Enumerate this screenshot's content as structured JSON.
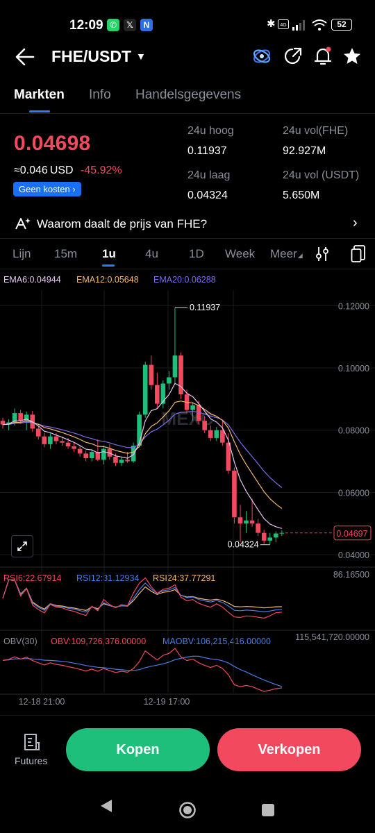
{
  "status_bar": {
    "time": "12:09",
    "apps": [
      "whatsapp-icon",
      "x-icon",
      "n-icon"
    ],
    "battery": "52"
  },
  "header": {
    "pair": "FHE/USDT",
    "icons": [
      "back-arrow-icon",
      "eye-icon",
      "share-icon",
      "bell-icon",
      "star-icon"
    ]
  },
  "tabs": [
    {
      "label": "Markten",
      "active": true
    },
    {
      "label": "Info",
      "active": false
    },
    {
      "label": "Handelsgegevens",
      "active": false
    }
  ],
  "price": {
    "last": "0.04698",
    "approx": "≈0.046",
    "approx_currency": "USD",
    "change": "-45.92%",
    "badge": "Geen kosten",
    "color_down": "#f2495e"
  },
  "stats": {
    "high_label": "24u hoog",
    "high": "0.11937",
    "vol_fhe_label": "24u vol(FHE)",
    "vol_fhe": "92.927M",
    "low_label": "24u laag",
    "low": "0.04324",
    "vol_usdt_label": "24u vol (USDT)",
    "vol_usdt": "5.650M"
  },
  "why_banner": {
    "text": "Waarom daalt de prijs van FHE?"
  },
  "intervals": [
    {
      "label": "Lijn"
    },
    {
      "label": "15m"
    },
    {
      "label": "1u",
      "active": true
    },
    {
      "label": "4u"
    },
    {
      "label": "1D"
    },
    {
      "label": "Week"
    },
    {
      "label": "Meer"
    }
  ],
  "indicators": {
    "ema6": "EMA6:0.04944",
    "ema12": "EMA12:0.05648",
    "ema20": "EMA20:0.06288",
    "rsi6": "RSI6:22.67914",
    "rsi12": "RSI12:31.12934",
    "rsi24": "RSI24:37.77291",
    "obv_title": "OBV(30)",
    "obv": "OBV:109,726,376.00000",
    "maobv": "MAOBV:106,215,416.00000"
  },
  "chart_data": {
    "type": "candlestick",
    "y_ticks": [
      "0.12000",
      "0.10000",
      "0.08000",
      "0.06000",
      "0.04000"
    ],
    "ylim": [
      0.038,
      0.125
    ],
    "x_ticks": [
      "12-18 21:00",
      "12-19 17:00"
    ],
    "high_marker": "0.11937",
    "low_marker": "0.04324",
    "last_price_tag": "0.04697",
    "rsi_max_label": "86.16500",
    "obv_max_label": "115,541,720.00000",
    "colors": {
      "up": "#1ebf7b",
      "down": "#f2495e",
      "ema6": "#e8c5f0",
      "ema12": "#f5b871",
      "ema20": "#7c6cf0",
      "rsi12": "#4a7de8"
    },
    "candles": [
      {
        "o": 0.083,
        "h": 0.084,
        "l": 0.0805,
        "c": 0.0818
      },
      {
        "o": 0.0818,
        "h": 0.0835,
        "l": 0.08,
        "c": 0.0825
      },
      {
        "o": 0.0825,
        "h": 0.087,
        "l": 0.0815,
        "c": 0.0855
      },
      {
        "o": 0.0855,
        "h": 0.0865,
        "l": 0.082,
        "c": 0.083
      },
      {
        "o": 0.083,
        "h": 0.086,
        "l": 0.08,
        "c": 0.085
      },
      {
        "o": 0.085,
        "h": 0.0862,
        "l": 0.0795,
        "c": 0.0805
      },
      {
        "o": 0.0805,
        "h": 0.0815,
        "l": 0.077,
        "c": 0.078
      },
      {
        "o": 0.078,
        "h": 0.0792,
        "l": 0.0745,
        "c": 0.0755
      },
      {
        "o": 0.0755,
        "h": 0.079,
        "l": 0.074,
        "c": 0.078
      },
      {
        "o": 0.078,
        "h": 0.079,
        "l": 0.0755,
        "c": 0.0765
      },
      {
        "o": 0.0765,
        "h": 0.078,
        "l": 0.075,
        "c": 0.076
      },
      {
        "o": 0.076,
        "h": 0.0775,
        "l": 0.074,
        "c": 0.0748
      },
      {
        "o": 0.0748,
        "h": 0.076,
        "l": 0.073,
        "c": 0.074
      },
      {
        "o": 0.074,
        "h": 0.075,
        "l": 0.0715,
        "c": 0.0725
      },
      {
        "o": 0.0725,
        "h": 0.0735,
        "l": 0.07,
        "c": 0.071
      },
      {
        "o": 0.071,
        "h": 0.074,
        "l": 0.07,
        "c": 0.073
      },
      {
        "o": 0.073,
        "h": 0.077,
        "l": 0.07,
        "c": 0.0705
      },
      {
        "o": 0.0705,
        "h": 0.075,
        "l": 0.069,
        "c": 0.074
      },
      {
        "o": 0.074,
        "h": 0.0755,
        "l": 0.0705,
        "c": 0.0715
      },
      {
        "o": 0.0715,
        "h": 0.0725,
        "l": 0.0685,
        "c": 0.0695
      },
      {
        "o": 0.0695,
        "h": 0.0715,
        "l": 0.0685,
        "c": 0.0705
      },
      {
        "o": 0.0705,
        "h": 0.073,
        "l": 0.0695,
        "c": 0.07
      },
      {
        "o": 0.07,
        "h": 0.076,
        "l": 0.0695,
        "c": 0.075
      },
      {
        "o": 0.075,
        "h": 0.086,
        "l": 0.0745,
        "c": 0.085
      },
      {
        "o": 0.085,
        "h": 0.102,
        "l": 0.084,
        "c": 0.101
      },
      {
        "o": 0.101,
        "h": 0.104,
        "l": 0.093,
        "c": 0.0945
      },
      {
        "o": 0.0945,
        "h": 0.0985,
        "l": 0.087,
        "c": 0.0885
      },
      {
        "o": 0.0885,
        "h": 0.096,
        "l": 0.087,
        "c": 0.095
      },
      {
        "o": 0.095,
        "h": 0.099,
        "l": 0.093,
        "c": 0.097
      },
      {
        "o": 0.097,
        "h": 0.1194,
        "l": 0.095,
        "c": 0.104
      },
      {
        "o": 0.104,
        "h": 0.105,
        "l": 0.09,
        "c": 0.0915
      },
      {
        "o": 0.0915,
        "h": 0.093,
        "l": 0.0855,
        "c": 0.0865
      },
      {
        "o": 0.0865,
        "h": 0.089,
        "l": 0.083,
        "c": 0.088
      },
      {
        "o": 0.088,
        "h": 0.0895,
        "l": 0.082,
        "c": 0.083
      },
      {
        "o": 0.083,
        "h": 0.0845,
        "l": 0.079,
        "c": 0.08
      },
      {
        "o": 0.08,
        "h": 0.0815,
        "l": 0.0765,
        "c": 0.0775
      },
      {
        "o": 0.0775,
        "h": 0.081,
        "l": 0.0765,
        "c": 0.08
      },
      {
        "o": 0.08,
        "h": 0.083,
        "l": 0.075,
        "c": 0.076
      },
      {
        "o": 0.076,
        "h": 0.079,
        "l": 0.066,
        "c": 0.067
      },
      {
        "o": 0.067,
        "h": 0.068,
        "l": 0.05,
        "c": 0.052
      },
      {
        "o": 0.052,
        "h": 0.056,
        "l": 0.044,
        "c": 0.05
      },
      {
        "o": 0.05,
        "h": 0.054,
        "l": 0.047,
        "c": 0.051
      },
      {
        "o": 0.051,
        "h": 0.058,
        "l": 0.049,
        "c": 0.05
      },
      {
        "o": 0.05,
        "h": 0.0515,
        "l": 0.046,
        "c": 0.047
      },
      {
        "o": 0.047,
        "h": 0.048,
        "l": 0.0435,
        "c": 0.0445
      },
      {
        "o": 0.0445,
        "h": 0.047,
        "l": 0.0432,
        "c": 0.0455
      },
      {
        "o": 0.0455,
        "h": 0.0475,
        "l": 0.044,
        "c": 0.0468
      },
      {
        "o": 0.0468,
        "h": 0.0478,
        "l": 0.046,
        "c": 0.047
      }
    ]
  },
  "bottom_bar": {
    "futures_label": "Futures",
    "buy_label": "Kopen",
    "sell_label": "Verkopen"
  }
}
